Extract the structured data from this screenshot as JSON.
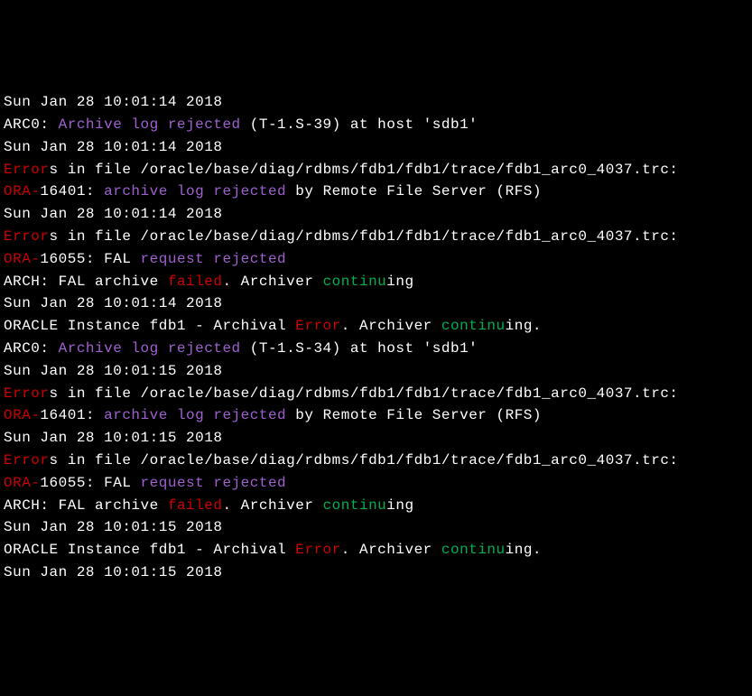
{
  "lines": [
    {
      "segments": [
        {
          "class": "white",
          "text": "Sun Jan 28 10:01:14 2018"
        }
      ]
    },
    {
      "segments": [
        {
          "class": "white",
          "text": "ARC0: "
        },
        {
          "class": "purple",
          "text": "Archive log rejected"
        },
        {
          "class": "white",
          "text": " (T-1.S-39) at host 'sdb1'"
        }
      ]
    },
    {
      "segments": [
        {
          "class": "white",
          "text": "Sun Jan 28 10:01:14 2018"
        }
      ]
    },
    {
      "segments": [
        {
          "class": "red",
          "text": "Error"
        },
        {
          "class": "white",
          "text": "s in file /oracle/base/diag/rdbms/fdb1/fdb1/trace/fdb1_arc0_4037.trc:"
        }
      ]
    },
    {
      "segments": [
        {
          "class": "red",
          "text": "ORA-"
        },
        {
          "class": "white",
          "text": "16401: "
        },
        {
          "class": "purple",
          "text": "archive log rejected"
        },
        {
          "class": "white",
          "text": " by Remote File Server (RFS)"
        }
      ]
    },
    {
      "segments": [
        {
          "class": "white",
          "text": "Sun Jan 28 10:01:14 2018"
        }
      ]
    },
    {
      "segments": [
        {
          "class": "red",
          "text": "Error"
        },
        {
          "class": "white",
          "text": "s in file /oracle/base/diag/rdbms/fdb1/fdb1/trace/fdb1_arc0_4037.trc:"
        }
      ]
    },
    {
      "segments": [
        {
          "class": "red",
          "text": "ORA-"
        },
        {
          "class": "white",
          "text": "16055: FAL "
        },
        {
          "class": "purple",
          "text": "request rejected"
        }
      ]
    },
    {
      "segments": [
        {
          "class": "white",
          "text": "ARCH: FAL archive "
        },
        {
          "class": "red",
          "text": "failed"
        },
        {
          "class": "white",
          "text": ". Archiver "
        },
        {
          "class": "green",
          "text": "continu"
        },
        {
          "class": "white",
          "text": "ing"
        }
      ]
    },
    {
      "segments": [
        {
          "class": "white",
          "text": "Sun Jan 28 10:01:14 2018"
        }
      ]
    },
    {
      "segments": [
        {
          "class": "white",
          "text": "ORACLE Instance fdb1 - Archival "
        },
        {
          "class": "red",
          "text": "Error"
        },
        {
          "class": "white",
          "text": ". Archiver "
        },
        {
          "class": "green",
          "text": "continu"
        },
        {
          "class": "white",
          "text": "ing."
        }
      ]
    },
    {
      "segments": [
        {
          "class": "white",
          "text": "ARC0: "
        },
        {
          "class": "purple",
          "text": "Archive log rejected"
        },
        {
          "class": "white",
          "text": " (T-1.S-34) at host 'sdb1'"
        }
      ]
    },
    {
      "segments": [
        {
          "class": "white",
          "text": "Sun Jan 28 10:01:15 2018"
        }
      ]
    },
    {
      "segments": [
        {
          "class": "red",
          "text": "Error"
        },
        {
          "class": "white",
          "text": "s in file /oracle/base/diag/rdbms/fdb1/fdb1/trace/fdb1_arc0_4037.trc:"
        }
      ]
    },
    {
      "segments": [
        {
          "class": "red",
          "text": "ORA-"
        },
        {
          "class": "white",
          "text": "16401: "
        },
        {
          "class": "purple",
          "text": "archive log rejected"
        },
        {
          "class": "white",
          "text": " by Remote File Server (RFS)"
        }
      ]
    },
    {
      "segments": [
        {
          "class": "white",
          "text": "Sun Jan 28 10:01:15 2018"
        }
      ]
    },
    {
      "segments": [
        {
          "class": "red",
          "text": "Error"
        },
        {
          "class": "white",
          "text": "s in file /oracle/base/diag/rdbms/fdb1/fdb1/trace/fdb1_arc0_4037.trc:"
        }
      ]
    },
    {
      "segments": [
        {
          "class": "red",
          "text": "ORA-"
        },
        {
          "class": "white",
          "text": "16055: FAL "
        },
        {
          "class": "purple",
          "text": "request rejected"
        }
      ]
    },
    {
      "segments": [
        {
          "class": "white",
          "text": "ARCH: FAL archive "
        },
        {
          "class": "red",
          "text": "failed"
        },
        {
          "class": "white",
          "text": ". Archiver "
        },
        {
          "class": "green",
          "text": "continu"
        },
        {
          "class": "white",
          "text": "ing"
        }
      ]
    },
    {
      "segments": [
        {
          "class": "white",
          "text": "Sun Jan 28 10:01:15 2018"
        }
      ]
    },
    {
      "segments": [
        {
          "class": "white",
          "text": "ORACLE Instance fdb1 - Archival "
        },
        {
          "class": "red",
          "text": "Error"
        },
        {
          "class": "white",
          "text": ". Archiver "
        },
        {
          "class": "green",
          "text": "continu"
        },
        {
          "class": "white",
          "text": "ing."
        }
      ]
    },
    {
      "segments": [
        {
          "class": "white",
          "text": "Sun Jan 28 10:01:15 2018"
        }
      ]
    }
  ]
}
